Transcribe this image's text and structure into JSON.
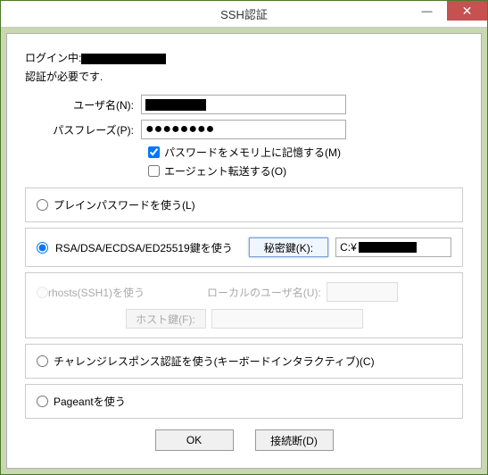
{
  "window": {
    "title": "SSH認証"
  },
  "login": {
    "prefix": "ログイン中:"
  },
  "auth_required": "認証が必要です.",
  "user": {
    "label": "ユーザ名(N):"
  },
  "passphrase": {
    "label": "パスフレーズ(P):",
    "value": "●●●●●●●●"
  },
  "remember": {
    "label": "パスワードをメモリ上に記憶する(M)"
  },
  "agent_forward": {
    "label": "エージェント転送する(O)"
  },
  "plain": {
    "label": "プレインパスワードを使う(L)"
  },
  "rsa": {
    "label": "RSA/DSA/ECDSA/ED25519鍵を使う",
    "btn": "秘密鍵(K):",
    "path_prefix": "C:¥"
  },
  "rhosts": {
    "label": "rhosts(SSH1)を使う",
    "local_label": "ローカルのユーザ名(U):",
    "hostkey_btn": "ホスト鍵(F):"
  },
  "challenge": {
    "label": "チャレンジレスポンス認証を使う(キーボードインタラクティブ)(C)"
  },
  "pageant": {
    "label": "Pageantを使う"
  },
  "buttons": {
    "ok": "OK",
    "disconnect": "接続断(D)"
  }
}
